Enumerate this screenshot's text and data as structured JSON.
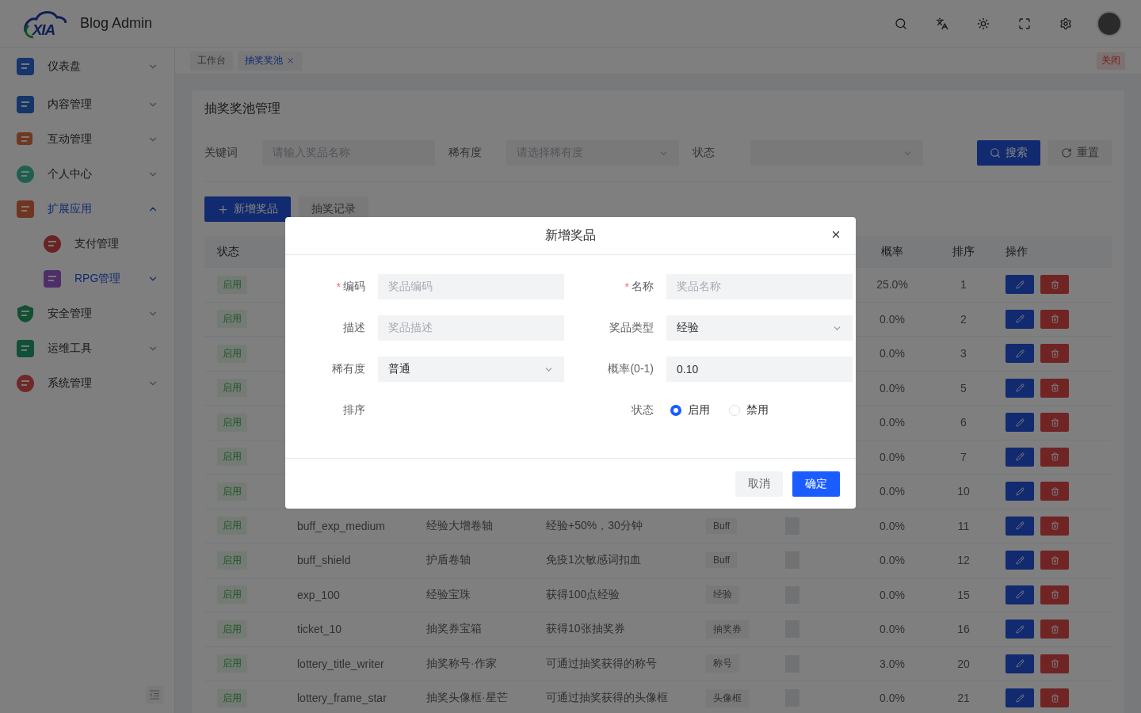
{
  "header": {
    "logo_text": "XIA",
    "title": "Blog Admin"
  },
  "sidebar": {
    "items": [
      {
        "label": "仪表盘",
        "selected": false,
        "expanded": false
      },
      {
        "label": "内容管理",
        "selected": false,
        "expanded": false
      },
      {
        "label": "互动管理",
        "selected": false,
        "expanded": false
      },
      {
        "label": "个人中心",
        "selected": false,
        "expanded": false
      },
      {
        "label": "扩展应用",
        "selected": true,
        "expanded": true,
        "children": [
          {
            "label": "支付管理",
            "selected": false,
            "has_children": false,
            "expanded": false
          },
          {
            "label": "RPG管理",
            "selected": true,
            "has_children": true,
            "expanded": false
          }
        ]
      },
      {
        "label": "安全管理",
        "selected": false,
        "expanded": false
      },
      {
        "label": "运维工具",
        "selected": false,
        "expanded": false
      },
      {
        "label": "系统管理",
        "selected": false,
        "expanded": false
      }
    ]
  },
  "tabs": [
    {
      "label": "工作台",
      "selected": false,
      "closable": false
    },
    {
      "label": "抽奖奖池",
      "selected": true,
      "closable": true
    }
  ],
  "close_all_button": "关闭",
  "page": {
    "title": "抽奖奖池管理",
    "filters": [
      {
        "label": "关键词",
        "kind": "input",
        "placeholder": "请输入奖品名称"
      },
      {
        "label": "稀有度",
        "kind": "select",
        "placeholder": "请选择稀有度"
      },
      {
        "label": "状态",
        "kind": "select"
      }
    ],
    "search_button": "搜索",
    "reset_button": "重置",
    "add_button": "新增奖品",
    "records_button": "抽奖记录"
  },
  "table": {
    "columns": [
      "状态",
      "概率",
      "排序",
      "操作"
    ],
    "rows": [
      {
        "status": "启用",
        "probability": "25.0%",
        "order": "1"
      },
      {
        "status": "启用",
        "probability": "0.0%",
        "order": "2"
      },
      {
        "status": "启用",
        "probability": "0.0%",
        "order": "3"
      },
      {
        "status": "启用",
        "probability": "0.0%",
        "order": "5"
      },
      {
        "status": "启用",
        "probability": "0.0%",
        "order": "6"
      },
      {
        "status": "启用",
        "probability": "0.0%",
        "order": "7"
      },
      {
        "status": "启用",
        "probability": "0.0%",
        "order": "10"
      },
      {
        "status": "启用",
        "code": "buff_exp_medium",
        "name": "经验大增卷轴",
        "description": "经验+50%，30分钟",
        "type": "Buff",
        "probability": "0.0%",
        "order": "11"
      },
      {
        "status": "启用",
        "code": "buff_shield",
        "name": "护盾卷轴",
        "description": "免疫1次敏感词扣血",
        "type": "Buff",
        "probability": "0.0%",
        "order": "12"
      },
      {
        "status": "启用",
        "code": "exp_100",
        "name": "经验宝珠",
        "description": "获得100点经验",
        "type": "经验",
        "probability": "0.0%",
        "order": "15"
      },
      {
        "status": "启用",
        "code": "ticket_10",
        "name": "抽奖券宝箱",
        "description": "获得10张抽奖券",
        "type": "抽奖券",
        "probability": "0.0%",
        "order": "16"
      },
      {
        "status": "启用",
        "code": "lottery_title_writer",
        "name": "抽奖称号·作家",
        "description": "可通过抽奖获得的称号",
        "type": "称号",
        "probability": "3.0%",
        "order": "20"
      },
      {
        "status": "启用",
        "code": "lottery_frame_star",
        "name": "抽奖头像框·星芒",
        "description": "可通过抽奖获得的头像框",
        "type": "头像框",
        "probability": "0.0%",
        "order": "21"
      }
    ]
  },
  "dialog": {
    "title": "新增奖品",
    "required_mark": "*",
    "fields": [
      {
        "label": "编码",
        "required": true,
        "kind": "input",
        "placeholder": "奖品编码"
      },
      {
        "label": "名称",
        "required": true,
        "kind": "input",
        "placeholder": "奖品名称"
      },
      {
        "label": "描述",
        "required": false,
        "kind": "input",
        "placeholder": "奖品描述"
      },
      {
        "label": "奖品类型",
        "required": false,
        "kind": "select",
        "value": "经验"
      },
      {
        "label": "稀有度",
        "required": false,
        "kind": "select",
        "value": "普通"
      },
      {
        "label": "概率(0-1)",
        "required": false,
        "kind": "input",
        "value": "0.10"
      },
      {
        "label": "排序",
        "required": false,
        "kind": "empty"
      },
      {
        "label": "状态",
        "required": false,
        "kind": "radio",
        "options": [
          {
            "label": "启用",
            "selected": true
          },
          {
            "label": "禁用",
            "selected": false
          }
        ]
      }
    ],
    "cancel_button": "取消",
    "ok_button": "确定"
  }
}
